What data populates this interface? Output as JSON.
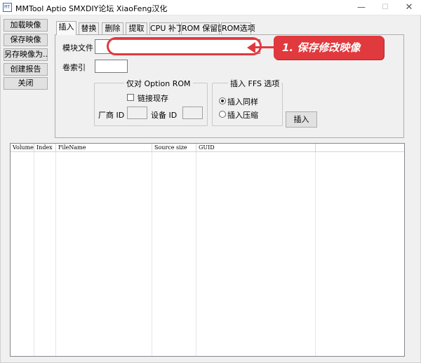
{
  "window": {
    "title": "MMTool Aptio SMXDIY论坛 XiaoFeng汉化",
    "icon_text": "MT",
    "minimize": "—",
    "maximize": "☐",
    "close": "✕"
  },
  "left_buttons": {
    "load": "加载映像",
    "save": "保存映像",
    "save_as": "另存映像为...",
    "report": "创建报告",
    "close": "关闭"
  },
  "tabs": {
    "insert": "插入",
    "replace": "替换",
    "delete": "删除",
    "extract": "提取",
    "cpu_patch": "CPU 补丁",
    "rom_hold": "ROM 保留区",
    "rom_options": "ROM选项"
  },
  "insert_panel": {
    "module_file_label": "模块文件",
    "module_file_value": "",
    "volume_index_label": "卷索引",
    "volume_index_value": "",
    "option_rom_group": "仅对 Option ROM",
    "link_present_label": "链接现存",
    "vendor_id_label": "厂商 ID",
    "device_id_label": "设备 ID",
    "ffs_group": "插入 FFS 选项",
    "insert_as_is": "插入同样",
    "insert_compressed": "插入压缩",
    "insert_button": "插入"
  },
  "annotation": {
    "text": "1. 保存修改映像",
    "color": "#e0393e"
  },
  "list": {
    "columns": [
      "Volume",
      "Index",
      "FileName",
      "Source size",
      "GUID"
    ]
  }
}
